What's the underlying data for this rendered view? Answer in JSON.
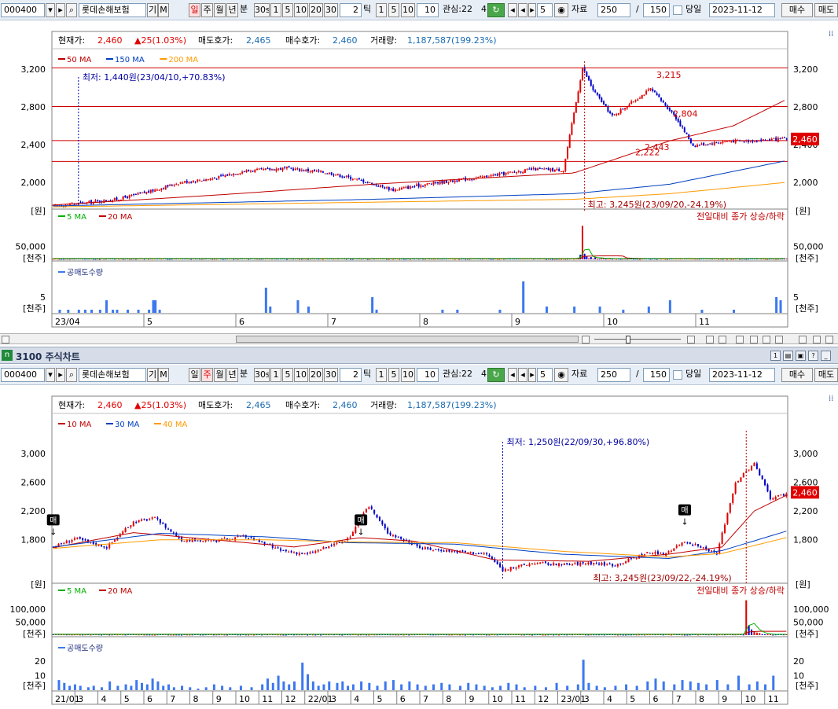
{
  "toolbar": {
    "code": "000400",
    "name": "롯데손해보험",
    "gi": "기",
    "m": "M",
    "period_buttons": [
      "일",
      "주",
      "월",
      "년",
      "분"
    ],
    "interval_buttons": [
      "30s",
      "1",
      "5",
      "10",
      "20",
      "30"
    ],
    "tick_value": "2",
    "tick_label": "틱",
    "tick_buttons": [
      "1",
      "5",
      "10"
    ],
    "tick_field": "10",
    "interest_label": "관심:22",
    "interest_suffix": "4",
    "step_value": "5",
    "data_label": "자료",
    "data_count": "250",
    "slash": "/",
    "data_total": "150",
    "same_day_label": "당일",
    "date": "2023-11-12",
    "buy_label": "매수",
    "sell_label": "매도"
  },
  "window_title": "3100 주식차트",
  "window_icon": "n",
  "summary": {
    "current_label": "현재가:",
    "current_value": "2,460",
    "change": "▲25(1.03%)",
    "ask_label": "매도호가:",
    "ask_value": "2,465",
    "bid_label": "매수호가:",
    "bid_value": "2,460",
    "volume_label": "거래량:",
    "volume_value": "1,187,587(199.23%)"
  },
  "colors": {
    "up": "#e00000",
    "down": "#0000c8",
    "ma_short": "#c00000",
    "ma_mid": "#0040c0",
    "ma_long": "#ff9a00",
    "vol_ma5": "#00b000",
    "vol_ma20": "#c00000",
    "short_sale": "#3c78f0",
    "current_tag": "#e00000"
  },
  "chart_data": [
    {
      "type": "candlestick",
      "id": "daily",
      "unit_label": "[원]",
      "ylim": [
        1750,
        3300
      ],
      "yticks": [
        2000,
        2400,
        2800,
        3200
      ],
      "ytick_labels": [
        "2,000",
        "2,400",
        "2,800",
        "3,200"
      ],
      "current_tag": "2,460",
      "legend": [
        {
          "label": "50 MA",
          "color": "#c00000"
        },
        {
          "label": "150 MA",
          "color": "#0040c0"
        },
        {
          "label": "200 MA",
          "color": "#ff9a00"
        }
      ],
      "hlines": [
        3215,
        2804,
        2443,
        2222
      ],
      "annotations": {
        "min_label": "최저: 1,440원(23/04/10,+70.83%)",
        "max_label": "최고: 3,245원(23/09/20,-24.19%)",
        "level_labels": [
          "3,215",
          "2,804",
          "2,443",
          "2,222"
        ]
      },
      "x_labels": [
        "23/04",
        "5",
        "6",
        "7",
        "8",
        "9",
        "10",
        "11"
      ],
      "anchors": [
        [
          0,
          1750
        ],
        [
          18,
          1790
        ],
        [
          30,
          1820
        ],
        [
          45,
          1900
        ],
        [
          60,
          2000
        ],
        [
          75,
          2040
        ],
        [
          90,
          2120
        ],
        [
          110,
          2150
        ],
        [
          130,
          2100
        ],
        [
          145,
          2020
        ],
        [
          160,
          1920
        ],
        [
          178,
          1990
        ],
        [
          200,
          2050
        ],
        [
          226,
          2140
        ],
        [
          240,
          2130
        ],
        [
          249,
          3215
        ],
        [
          254,
          2980
        ],
        [
          263,
          2700
        ],
        [
          281,
          2990
        ],
        [
          292,
          2720
        ],
        [
          301,
          2390
        ],
        [
          318,
          2440
        ],
        [
          326,
          2440
        ],
        [
          345,
          2460
        ]
      ],
      "ma_series": [
        {
          "name": "50 MA",
          "color": "#c00000",
          "points": [
            [
              0,
              1760
            ],
            [
              80,
              1870
            ],
            [
              150,
              1980
            ],
            [
              245,
              2100
            ],
            [
              290,
              2440
            ],
            [
              320,
              2600
            ],
            [
              345,
              2880
            ]
          ]
        },
        {
          "name": "150 MA",
          "color": "#0040c0",
          "points": [
            [
              0,
              1750
            ],
            [
              150,
              1820
            ],
            [
              245,
              1880
            ],
            [
              290,
              1980
            ],
            [
              345,
              2230
            ]
          ]
        },
        {
          "name": "200 MA",
          "color": "#ff9a00",
          "points": [
            [
              0,
              1740
            ],
            [
              150,
              1790
            ],
            [
              245,
              1820
            ],
            [
              290,
              1880
            ],
            [
              345,
              2000
            ]
          ]
        }
      ],
      "volume": {
        "unit_label": "[천주]",
        "ylim": [
          0,
          140000
        ],
        "yticks": [
          50000
        ],
        "ytick_labels": [
          "50,000"
        ],
        "legend": [
          {
            "label": "5 MA",
            "color": "#00b000"
          },
          {
            "label": "20 MA",
            "color": "#c00000"
          }
        ],
        "caption": "전일대비 종가 상승/하락",
        "spikes": [
          [
            249,
            130000
          ],
          [
            248,
            18000
          ],
          [
            250,
            22000
          ],
          [
            251,
            12000
          ],
          [
            253,
            9000
          ],
          [
            255,
            8000
          ],
          [
            258,
            6000
          ]
        ]
      },
      "short_sale": {
        "unit_label": "[천주]",
        "title": "공매도수량",
        "ytick_labels": [
          "5"
        ],
        "yticks": [
          5
        ],
        "ylim": [
          0,
          11
        ],
        "bars": [
          [
            3,
            1
          ],
          [
            7,
            1
          ],
          [
            12,
            1
          ],
          [
            15,
            1
          ],
          [
            18,
            1
          ],
          [
            22,
            1
          ],
          [
            25,
            4
          ],
          [
            28,
            1
          ],
          [
            30,
            1
          ],
          [
            35,
            1
          ],
          [
            40,
            1
          ],
          [
            45,
            1
          ],
          [
            47,
            4
          ],
          [
            48,
            4
          ],
          [
            50,
            1
          ],
          [
            100,
            8
          ],
          [
            102,
            2
          ],
          [
            115,
            4
          ],
          [
            120,
            2
          ],
          [
            150,
            5
          ],
          [
            152,
            1
          ],
          [
            183,
            1
          ],
          [
            190,
            1
          ],
          [
            210,
            1
          ],
          [
            221,
            10
          ],
          [
            232,
            2
          ],
          [
            245,
            2
          ],
          [
            257,
            2
          ],
          [
            268,
            1
          ],
          [
            280,
            2
          ],
          [
            290,
            4
          ],
          [
            305,
            1
          ],
          [
            320,
            1
          ],
          [
            340,
            5
          ],
          [
            342,
            4
          ]
        ]
      }
    },
    {
      "type": "candlestick",
      "id": "weekly",
      "unit_label": "[원]",
      "ylim": [
        1250,
        3350
      ],
      "yticks": [
        1800,
        2200,
        2600,
        3000
      ],
      "ytick_labels": [
        "1,800",
        "2,200",
        "2,600",
        "3,000"
      ],
      "current_tag": "2,460",
      "legend": [
        {
          "label": "10 MA",
          "color": "#c00000"
        },
        {
          "label": "30 MA",
          "color": "#0040c0"
        },
        {
          "label": "40 MA",
          "color": "#ff9a00"
        }
      ],
      "annotations": {
        "min_label": "최저: 1,250원(22/09/30,+96.80%)",
        "max_label": "최고: 3,245원(23/09/22,-24.19%)",
        "buy_marks": [
          "매",
          "매",
          "매"
        ]
      },
      "x_labels": [
        "21/01",
        "3",
        "4",
        "5",
        "6",
        "7",
        "8",
        "9",
        "10",
        "11",
        "12",
        "22/01",
        "3",
        "4",
        "5",
        "6",
        "7",
        "8",
        "9",
        "10",
        "11",
        "12",
        "23/01",
        "3",
        "4",
        "5",
        "6",
        "7",
        "8",
        "9",
        "10",
        "11"
      ],
      "anchors": [
        [
          0,
          1700
        ],
        [
          8,
          1820
        ],
        [
          20,
          1700
        ],
        [
          30,
          2050
        ],
        [
          38,
          2100
        ],
        [
          48,
          1800
        ],
        [
          60,
          1780
        ],
        [
          72,
          1850
        ],
        [
          85,
          1650
        ],
        [
          95,
          1600
        ],
        [
          110,
          1800
        ],
        [
          118,
          2270
        ],
        [
          125,
          1900
        ],
        [
          138,
          1680
        ],
        [
          148,
          1650
        ],
        [
          162,
          1600
        ],
        [
          168,
          1380
        ],
        [
          180,
          1480
        ],
        [
          190,
          1450
        ],
        [
          200,
          1480
        ],
        [
          210,
          1450
        ],
        [
          222,
          1620
        ],
        [
          228,
          1600
        ],
        [
          236,
          1780
        ],
        [
          248,
          1600
        ],
        [
          255,
          2600
        ],
        [
          262,
          2860
        ],
        [
          268,
          2380
        ],
        [
          274,
          2440
        ]
      ],
      "ma_series": [
        {
          "name": "10 MA",
          "color": "#c00000",
          "points": [
            [
              0,
              1690
            ],
            [
              30,
              1900
            ],
            [
              60,
              1800
            ],
            [
              90,
              1700
            ],
            [
              115,
              1830
            ],
            [
              135,
              1780
            ],
            [
              165,
              1520
            ],
            [
              200,
              1500
            ],
            [
              230,
              1600
            ],
            [
              250,
              1700
            ],
            [
              262,
              2200
            ],
            [
              274,
              2420
            ]
          ]
        },
        {
          "name": "30 MA",
          "color": "#0040c0",
          "points": [
            [
              0,
              1700
            ],
            [
              40,
              1890
            ],
            [
              80,
              1840
            ],
            [
              110,
              1760
            ],
            [
              150,
              1740
            ],
            [
              190,
              1600
            ],
            [
              230,
              1540
            ],
            [
              250,
              1650
            ],
            [
              274,
              1920
            ]
          ]
        },
        {
          "name": "40 MA",
          "color": "#ff9a00",
          "points": [
            [
              0,
              1680
            ],
            [
              40,
              1800
            ],
            [
              80,
              1800
            ],
            [
              110,
              1770
            ],
            [
              150,
              1760
            ],
            [
              190,
              1640
            ],
            [
              230,
              1560
            ],
            [
              250,
              1610
            ],
            [
              274,
              1830
            ]
          ]
        }
      ],
      "volume": {
        "unit_label": "[천주]",
        "ylim": [
          0,
          140000
        ],
        "yticks": [
          50000,
          100000
        ],
        "ytick_labels": [
          "50,000",
          "100,000"
        ],
        "legend": [
          {
            "label": "5 MA",
            "color": "#00b000"
          },
          {
            "label": "20 MA",
            "color": "#c00000"
          }
        ],
        "caption": "전일대비 종가 상승/하락",
        "spikes": [
          [
            259,
            135000
          ],
          [
            260,
            38000
          ],
          [
            261,
            22000
          ],
          [
            262,
            15000
          ],
          [
            263,
            10000
          ],
          [
            264,
            8000
          ]
        ]
      },
      "short_sale": {
        "unit_label": "[천주]",
        "title": "공매도수량",
        "ytick_labels": [
          "10",
          "20"
        ],
        "yticks": [
          10,
          20
        ],
        "ylim": [
          0,
          25
        ],
        "bars": [
          [
            2,
            7
          ],
          [
            4,
            5
          ],
          [
            6,
            3
          ],
          [
            8,
            4
          ],
          [
            10,
            3
          ],
          [
            13,
            2
          ],
          [
            15,
            3
          ],
          [
            18,
            2
          ],
          [
            21,
            6
          ],
          [
            24,
            3
          ],
          [
            27,
            4
          ],
          [
            29,
            3
          ],
          [
            31,
            7
          ],
          [
            33,
            5
          ],
          [
            35,
            4
          ],
          [
            37,
            8
          ],
          [
            39,
            6
          ],
          [
            41,
            3
          ],
          [
            43,
            4
          ],
          [
            45,
            2
          ],
          [
            48,
            3
          ],
          [
            51,
            2
          ],
          [
            54,
            1
          ],
          [
            57,
            2
          ],
          [
            60,
            4
          ],
          [
            63,
            3
          ],
          [
            66,
            2
          ],
          [
            70,
            3
          ],
          [
            74,
            2
          ],
          [
            78,
            4
          ],
          [
            80,
            8
          ],
          [
            82,
            5
          ],
          [
            84,
            10
          ],
          [
            86,
            6
          ],
          [
            88,
            4
          ],
          [
            90,
            6
          ],
          [
            93,
            19
          ],
          [
            95,
            11
          ],
          [
            97,
            6
          ],
          [
            99,
            3
          ],
          [
            101,
            4
          ],
          [
            103,
            6
          ],
          [
            106,
            5
          ],
          [
            108,
            6
          ],
          [
            110,
            3
          ],
          [
            112,
            4
          ],
          [
            115,
            6
          ],
          [
            118,
            5
          ],
          [
            121,
            3
          ],
          [
            124,
            6
          ],
          [
            127,
            7
          ],
          [
            130,
            4
          ],
          [
            133,
            6
          ],
          [
            136,
            4
          ],
          [
            139,
            3
          ],
          [
            142,
            4
          ],
          [
            145,
            5
          ],
          [
            148,
            4
          ],
          [
            152,
            3
          ],
          [
            155,
            5
          ],
          [
            158,
            4
          ],
          [
            161,
            3
          ],
          [
            164,
            2
          ],
          [
            167,
            3
          ],
          [
            170,
            5
          ],
          [
            173,
            4
          ],
          [
            176,
            2
          ],
          [
            180,
            3
          ],
          [
            184,
            2
          ],
          [
            188,
            5
          ],
          [
            192,
            3
          ],
          [
            196,
            4
          ],
          [
            198,
            21
          ],
          [
            200,
            5
          ],
          [
            203,
            3
          ],
          [
            206,
            2
          ],
          [
            210,
            3
          ],
          [
            214,
            4
          ],
          [
            218,
            3
          ],
          [
            222,
            6
          ],
          [
            225,
            8
          ],
          [
            228,
            6
          ],
          [
            232,
            4
          ],
          [
            235,
            7
          ],
          [
            238,
            6
          ],
          [
            241,
            5
          ],
          [
            244,
            4
          ],
          [
            248,
            7
          ],
          [
            252,
            4
          ],
          [
            256,
            10
          ],
          [
            260,
            4
          ],
          [
            263,
            6
          ],
          [
            266,
            4
          ],
          [
            269,
            10
          ]
        ]
      }
    }
  ]
}
